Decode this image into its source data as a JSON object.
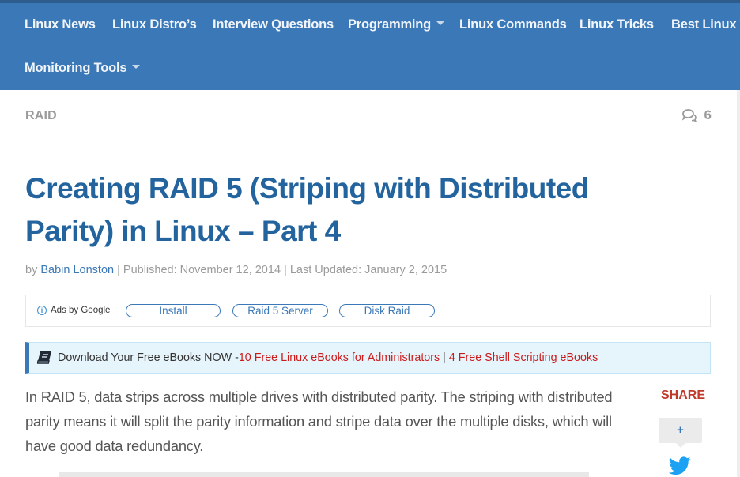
{
  "nav": {
    "items": [
      {
        "label": "Linux News",
        "dropdown": false
      },
      {
        "label": "Linux Distro’s",
        "dropdown": false
      },
      {
        "label": "Interview Questions",
        "dropdown": false
      },
      {
        "label": "Programming",
        "dropdown": true
      },
      {
        "label": "Linux Commands",
        "dropdown": false
      },
      {
        "label": "Linux Tricks",
        "dropdown": false
      },
      {
        "label": "Best Linux T",
        "dropdown": false
      },
      {
        "label": "Monitoring Tools",
        "dropdown": true
      }
    ]
  },
  "category": {
    "label": "RAID",
    "comment_count": "6"
  },
  "article": {
    "title": "Creating RAID 5 (Striping with Distributed Parity) in Linux – Part 4",
    "by": "by",
    "author": "Babin Lonston",
    "published": "| Published: November 12, 2014",
    "updated": "| Last Updated: January 2, 2015",
    "paragraph": "In RAID 5, data strips across multiple drives with distributed parity. The striping with distributed parity means it will split the parity information and stripe data over the multiple disks, which will have good data redundancy."
  },
  "ads": {
    "by_google": "Ads by Google",
    "info_icon": "i",
    "pills": [
      "Install",
      "Raid 5 Server",
      "Disk Raid"
    ]
  },
  "ebook": {
    "lead": "Download Your Free eBooks NOW - ",
    "link1": "10 Free Linux eBooks for Administrators",
    "separator": "|",
    "link2": "4 Free Shell Scripting eBooks"
  },
  "share": {
    "label": "SHARE",
    "plus": "+"
  },
  "colors": {
    "nav_bg": "#3b78b8",
    "title": "#24649e",
    "link_red": "#cc1b1b",
    "share_red": "#c0392b",
    "banner_bg": "#e6f4fb"
  }
}
